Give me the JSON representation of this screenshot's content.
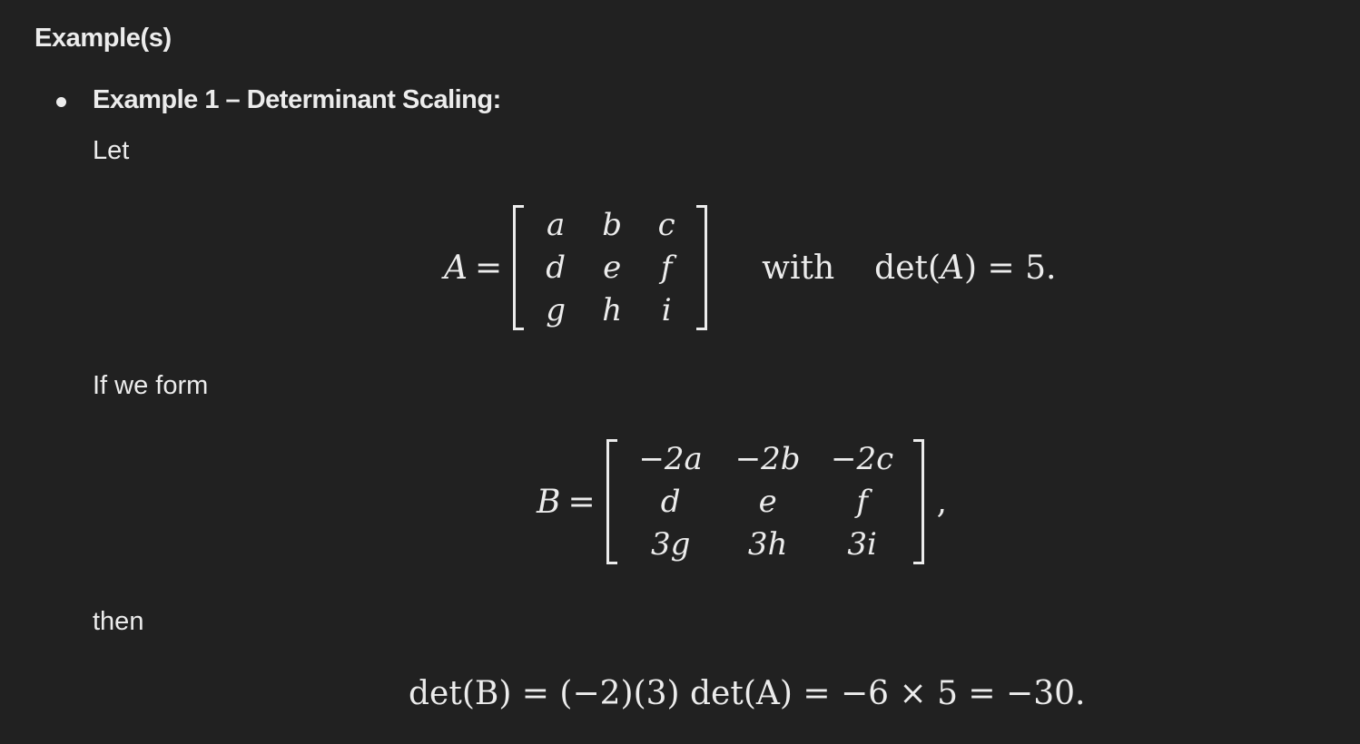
{
  "section_heading": "Example(s)",
  "bullet": {
    "title": "Example 1 – Determinant Scaling:"
  },
  "prose": {
    "let": "Let",
    "form": "If we form",
    "then": "then"
  },
  "matrixA": {
    "lhs": "A",
    "eq": "=",
    "rows": [
      [
        "a",
        "b",
        "c"
      ],
      [
        "d",
        "e",
        "f"
      ],
      [
        "g",
        "h",
        "i"
      ]
    ],
    "with": "with",
    "det_text": "det(",
    "det_arg": "A",
    "det_close": ") = 5."
  },
  "matrixB": {
    "lhs": "B",
    "eq": "=",
    "rows": [
      [
        "−2a",
        "−2b",
        "−2c"
      ],
      [
        "d",
        "e",
        "f"
      ],
      [
        "3g",
        "3h",
        "3i"
      ]
    ],
    "trail": ","
  },
  "final_equation": "det(B) = (−2)(3) det(A) = −6 × 5 = −30."
}
